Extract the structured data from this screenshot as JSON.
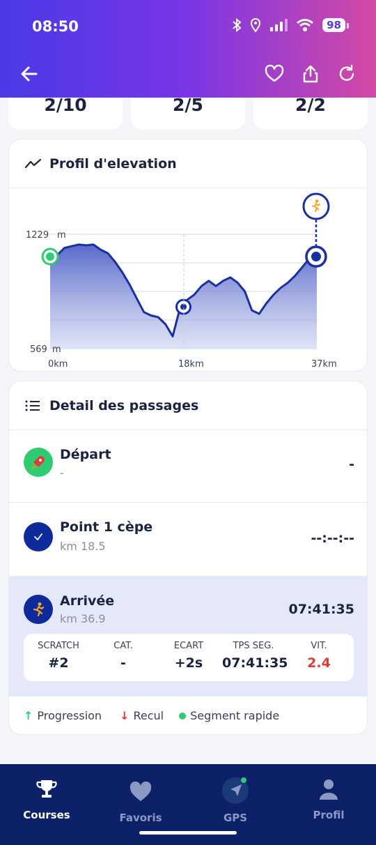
{
  "status": {
    "time": "08:50",
    "battery": "98"
  },
  "stats": [
    "2/10",
    "2/5",
    "2/2"
  ],
  "elevation": {
    "title": "Profil d'elevation",
    "y_max_label": "1229",
    "y_min_label": "569",
    "y_unit": "m",
    "x_labels": [
      "0km",
      "18km",
      "37km"
    ]
  },
  "chart_data": {
    "type": "area",
    "xlabel": "",
    "ylabel": "",
    "ylim": [
      569,
      1229
    ],
    "xlim": [
      0,
      37
    ],
    "x_unit": "km",
    "y_unit": "m",
    "x": [
      0,
      1,
      2,
      3,
      4,
      5,
      6,
      7,
      8,
      9,
      10,
      11,
      12,
      13,
      14,
      15,
      16,
      17,
      18,
      19,
      20,
      21,
      22,
      23,
      24,
      25,
      26,
      27,
      28,
      29,
      30,
      31,
      32,
      33,
      34,
      35,
      36,
      37
    ],
    "values": [
      1100,
      1110,
      1150,
      1160,
      1170,
      1165,
      1170,
      1140,
      1120,
      1070,
      1010,
      940,
      860,
      780,
      760,
      750,
      710,
      640,
      800,
      850,
      880,
      930,
      960,
      930,
      960,
      980,
      950,
      900,
      790,
      770,
      830,
      880,
      920,
      950,
      990,
      1040,
      1090,
      1100
    ],
    "markers": [
      {
        "label": "Départ",
        "x": 0,
        "y": 1100
      },
      {
        "label": "Point 1 cèpe",
        "x": 18.5,
        "y": 810
      },
      {
        "label": "Arrivée",
        "x": 36.9,
        "y": 1100
      }
    ]
  },
  "passages": {
    "title": "Detail des passages",
    "rows": [
      {
        "name": "Départ",
        "sub": "-",
        "time": "-"
      },
      {
        "name": "Point 1 cèpe",
        "sub": "km 18.5",
        "time": "--:--:--"
      },
      {
        "name": "Arrivée",
        "sub": "km 36.9",
        "time": "07:41:35"
      }
    ],
    "metrics": [
      {
        "label": "SCRATCH",
        "value": "#2"
      },
      {
        "label": "CAT.",
        "value": "-"
      },
      {
        "label": "ECART",
        "value": "+2s"
      },
      {
        "label": "TPS SEG.",
        "value": "07:41:35"
      },
      {
        "label": "VIT.",
        "value": "2.4"
      }
    ],
    "legend": {
      "progression": "Progression",
      "recul": "Recul",
      "segment": "Segment rapide"
    }
  },
  "nav": [
    {
      "label": "Courses",
      "icon": "trophy-icon"
    },
    {
      "label": "Favoris",
      "icon": "heart-icon"
    },
    {
      "label": "GPS",
      "icon": "navigation-icon"
    },
    {
      "label": "Profil",
      "icon": "person-icon"
    }
  ],
  "colors": {
    "accent": "#0c2167",
    "chart_line": "#1a2fa0",
    "green": "#2ecc71",
    "red": "#e53935"
  }
}
